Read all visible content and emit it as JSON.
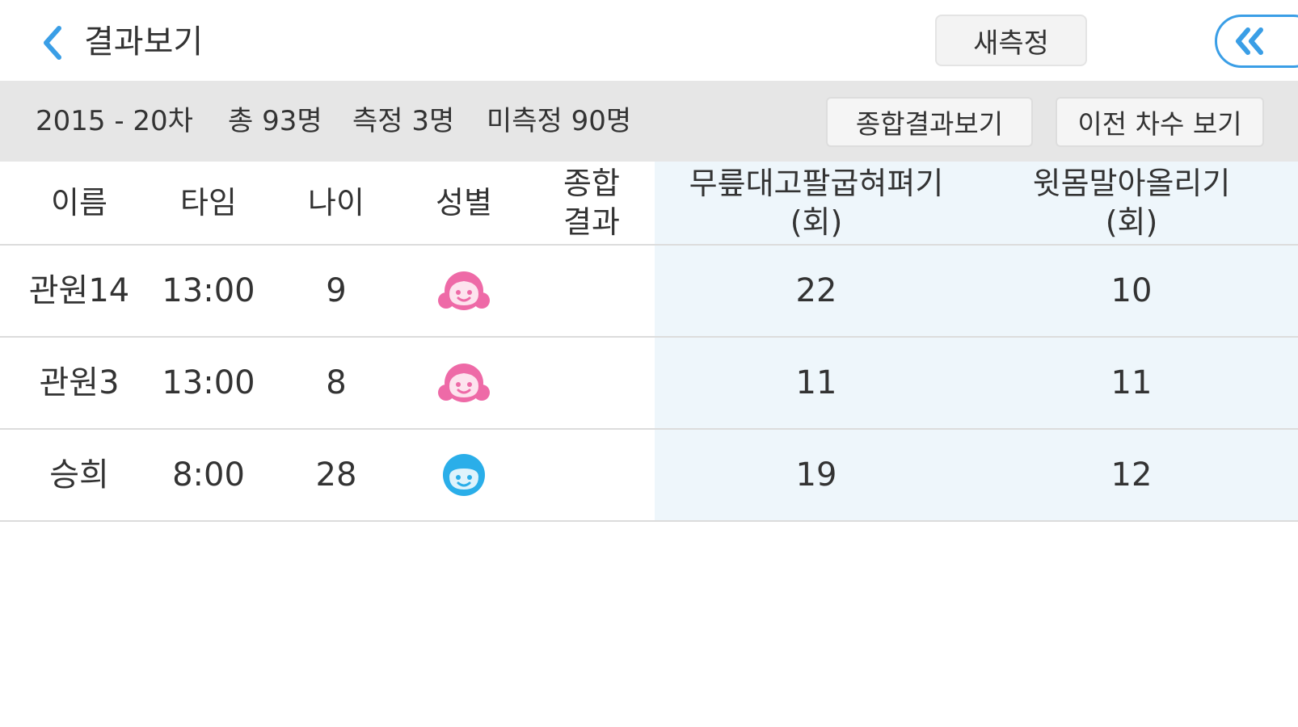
{
  "header": {
    "title": "결과보기",
    "new_measure_label": "새측정"
  },
  "info": {
    "round": "2015 - 20차",
    "total": "총 93명",
    "measured": "측정 3명",
    "unmeasured": "미측정 90명",
    "summary_button": "종합결과보기",
    "prev_round_button": "이전 차수 보기"
  },
  "table": {
    "headers": {
      "name": "이름",
      "time": "타임",
      "age": "나이",
      "gender": "성별",
      "total_line1": "종합",
      "total_line2": "결과",
      "col1_line1": "무릎대고팔굽혀펴기",
      "col1_line2": "(회)",
      "col2_line1": "윗몸말아올리기",
      "col2_line2": "(회)"
    },
    "rows": [
      {
        "name": "관원14",
        "time": "13:00",
        "age": "9",
        "gender": "female",
        "total": "",
        "col1": "22",
        "col2": "10"
      },
      {
        "name": "관원3",
        "time": "13:00",
        "age": "8",
        "gender": "female",
        "total": "",
        "col1": "11",
        "col2": "11"
      },
      {
        "name": "승희",
        "time": "8:00",
        "age": "28",
        "gender": "male",
        "total": "",
        "col1": "19",
        "col2": "12"
      }
    ]
  },
  "colors": {
    "accent": "#3a9ee6",
    "female_icon": "#ee6aa7",
    "male_icon": "#2aaee9",
    "info_bar": "#e6e6e6",
    "highlight_column_bg": "#eef6fb"
  },
  "icons": {
    "back": "chevron-left-icon",
    "collapse": "double-chevron-left-icon",
    "female": "girl-face-icon",
    "male": "boy-face-icon"
  }
}
